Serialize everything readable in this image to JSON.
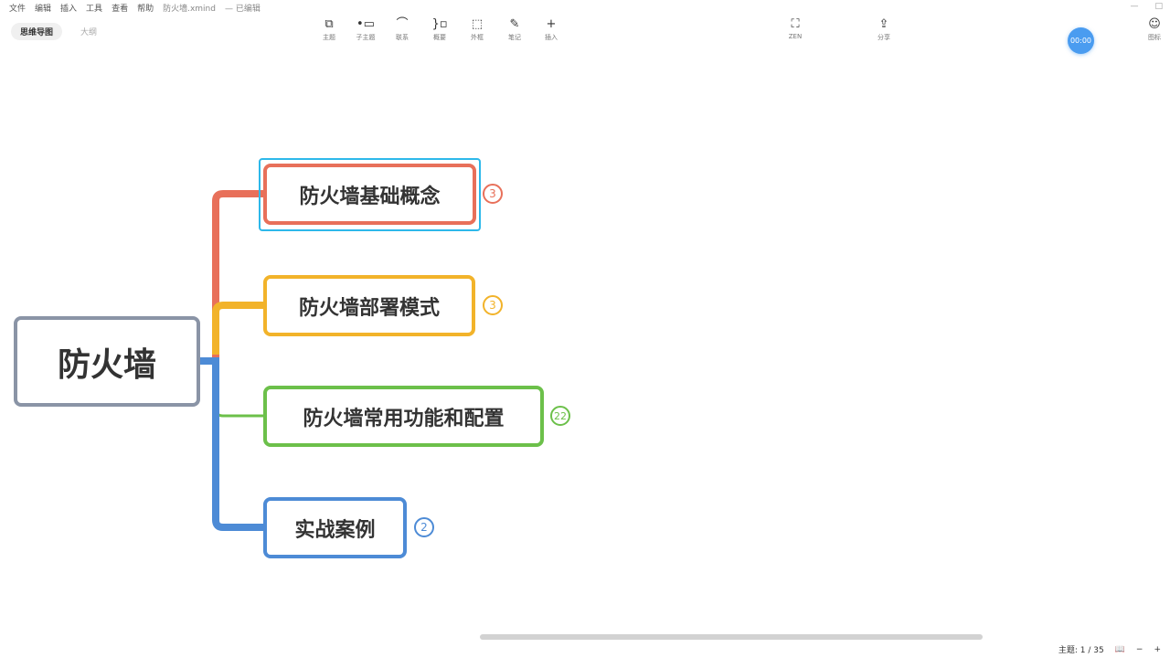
{
  "menubar": {
    "items": [
      "文件",
      "编辑",
      "插入",
      "工具",
      "查看",
      "帮助"
    ],
    "doc_title": "防火墙.xmind",
    "doc_status": "— 已编辑"
  },
  "tabs": [
    {
      "label": "思维导图",
      "active": true
    },
    {
      "label": "大纲",
      "active": false
    }
  ],
  "toolbar": [
    {
      "label": "主题",
      "icon": "topic-icon"
    },
    {
      "label": "子主题",
      "icon": "subtopic-icon"
    },
    {
      "label": "联系",
      "icon": "relationship-icon"
    },
    {
      "label": "概要",
      "icon": "summary-icon"
    },
    {
      "label": "外框",
      "icon": "boundary-icon"
    },
    {
      "label": "笔记",
      "icon": "note-icon"
    },
    {
      "label": "插入",
      "icon": "plus-icon"
    }
  ],
  "zen_label": "ZEN",
  "share_label": "分享",
  "icon_panel_label": "图标",
  "timer": "00:00",
  "map": {
    "central": "防火墙",
    "branches": [
      {
        "label": "防火墙基础概念",
        "count": "3",
        "color": "#e8705a",
        "selected": true
      },
      {
        "label": "防火墙部署模式",
        "count": "3",
        "color": "#f2b32a"
      },
      {
        "label": "防火墙常用功能和配置",
        "count": "22",
        "color": "#6cc04a"
      },
      {
        "label": "实战案例",
        "count": "2",
        "color": "#4d8bd6"
      }
    ]
  },
  "status": {
    "topic_count": "主题: 1 / 35"
  }
}
